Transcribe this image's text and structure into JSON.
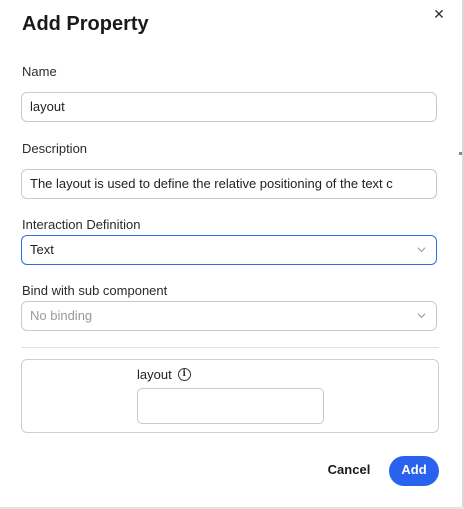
{
  "dialog": {
    "title": "Add Property",
    "close_icon": "close-icon"
  },
  "name": {
    "label": "Name",
    "value": "layout"
  },
  "description": {
    "label": "Description",
    "value": "The layout is used to define the relative positioning of the text c"
  },
  "interaction": {
    "label": "Interaction Definition",
    "selected": "Text"
  },
  "bind": {
    "label": "Bind with sub component",
    "selected": "No binding"
  },
  "preview": {
    "label": "layout",
    "info_icon": "info-icon",
    "value": ""
  },
  "actions": {
    "cancel_label": "Cancel",
    "add_label": "Add"
  },
  "colors": {
    "accent": "#2a62f0",
    "focus_border": "#2f6fe0"
  }
}
